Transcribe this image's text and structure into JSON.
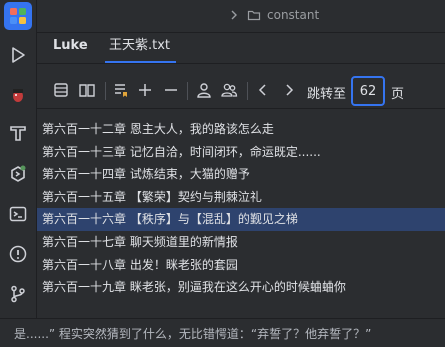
{
  "breadcrumb": {
    "folder": "constant"
  },
  "tabs": {
    "first": "Luke",
    "active_file": "王天紫.txt"
  },
  "toolbar": {
    "jump_label": "跳转至",
    "page_value": "62",
    "page_unit": "页"
  },
  "chapters": [
    "第六百一十二章 恩主大人，我的路该怎么走",
    "第六百一十三章 记忆自洽，时间闭环，命运既定......",
    "第六百一十四章 试炼结束，大猫的赠予",
    "第六百一十五章 【繁荣】契约与荆棘泣礼",
    "第六百一十六章 【秩序】与【混乱】的觐见之梯",
    "第六百一十七章 聊天频道里的新情报",
    "第六百一十八章 出发！眯老张的套园",
    "第六百一十九章 眯老张，别逼我在这么开心的时候蛐蛐你"
  ],
  "selected_index": 4,
  "status_text": "是......”  程实突然猜到了什么，无比错愕道：“弃誓了？他弃誓了？”"
}
